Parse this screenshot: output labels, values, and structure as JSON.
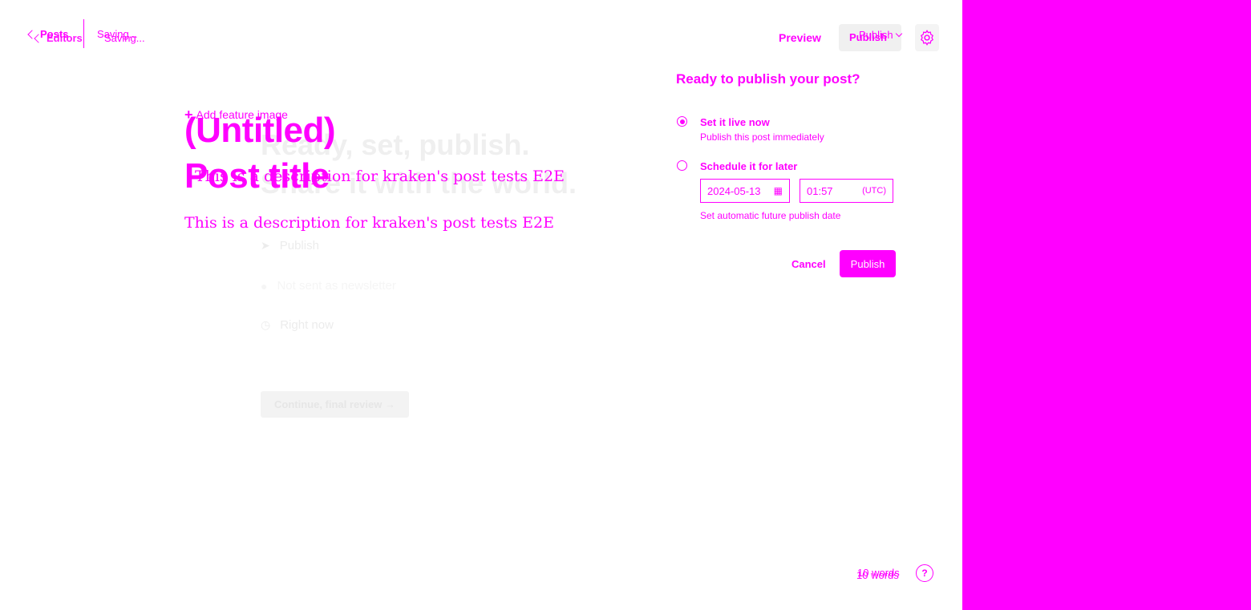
{
  "header": {
    "back_label": "Posts",
    "back_label_ghost": "Editors",
    "status_text": "Saving...",
    "status_text_ghost": "Saving...",
    "preview_label": "Preview",
    "publish_label": "Publish",
    "publish_dropdown_label": "Publish"
  },
  "editor": {
    "add_feature_image": "Add feature image",
    "title_untitled": "(Untitled)",
    "title_placeholder": "Post title",
    "excerpt": "This is a description for kraken's post tests E2E",
    "excerpt_ghost": "This is a description for kraken's post tests E2E",
    "word_count": "10 words",
    "word_count_ghost": "10 words"
  },
  "publish_flow_bg": {
    "heading_line1": "Ready, set, publish.",
    "heading_line2": "Share it with the world.",
    "row_publish": "Publish",
    "row_newsletter": "Not sent as newsletter",
    "row_time": "Right now",
    "continue_label": "Continue, final review →"
  },
  "publish_panel": {
    "title": "Ready to publish your post?",
    "option_now_title": "Set it live now",
    "option_now_sub": "Publish this post immediately",
    "option_later_title": "Schedule it for later",
    "date_value": "2024-05-13",
    "time_value": "01:57",
    "timezone": "(UTC)",
    "later_hint": "Set automatic future publish date",
    "cancel_label": "Cancel",
    "publish_label": "Publish"
  },
  "colors": {
    "accent": "#ff00ff",
    "background": "#ffffff"
  }
}
